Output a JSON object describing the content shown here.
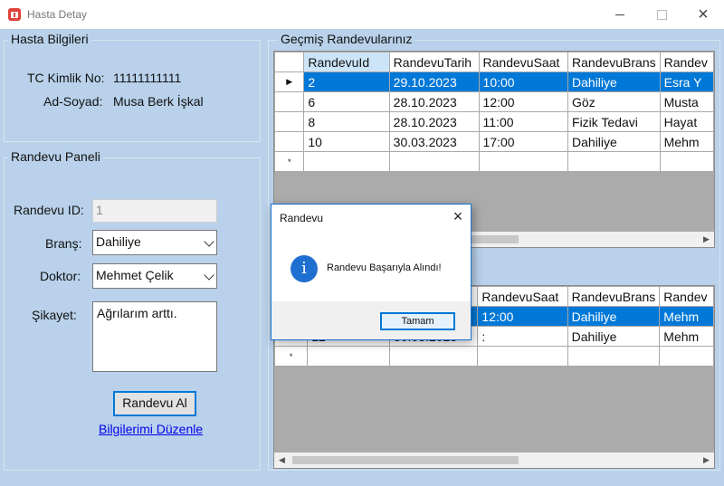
{
  "window": {
    "title": "Hasta Detay"
  },
  "patient_info": {
    "group_title": "Hasta Bilgileri",
    "tc_label": "TC Kimlik No:",
    "tc_value": "11111111111",
    "name_label": "Ad-Soyad:",
    "name_value": "Musa Berk İşkal"
  },
  "appointment_panel": {
    "group_title": "Randevu Paneli",
    "id_label": "Randevu ID:",
    "id_value": "1",
    "branch_label": "Branş:",
    "branch_value": "Dahiliye",
    "doctor_label": "Doktor:",
    "doctor_value": "Mehmet Çelik",
    "complaint_label": "Şikayet:",
    "complaint_value": "Ağrılarım arttı.",
    "submit_label": "Randevu Al",
    "edit_link": "Bilgilerimi Düzenle"
  },
  "history": {
    "group_title": "Geçmiş Randevularınız",
    "columns": [
      "RandevuId",
      "RandevuTarih",
      "RandevuSaat",
      "RandevuBrans",
      "Randev"
    ],
    "rows": [
      [
        "2",
        "29.10.2023",
        "10:00",
        "Dahiliye",
        "Esra Y"
      ],
      [
        "6",
        "28.10.2023",
        "12:00",
        "Göz",
        "Musta"
      ],
      [
        "8",
        "28.10.2023",
        "11:00",
        "Fizik Tedavi",
        "Hayat"
      ],
      [
        "10",
        "30.03.2023",
        "17:00",
        "Dahiliye",
        "Mehm"
      ]
    ],
    "selected_row_marker": "▶",
    "new_row_marker": "*"
  },
  "active": {
    "columns": [
      "",
      "",
      "RandevuSaat",
      "RandevuBrans",
      "Randev"
    ],
    "rows": [
      [
        "",
        "",
        "12:00",
        "Dahiliye",
        "Mehm"
      ],
      [
        "12",
        "30.03.2023",
        ":",
        "Dahiliye",
        "Mehm"
      ]
    ],
    "new_row_marker": "*"
  },
  "dialog": {
    "title": "Randevu",
    "message": "Randevu Başarıyla Alındı!",
    "ok_label": "Tamam",
    "icon_glyph": "i"
  },
  "colors": {
    "form_bg": "#b9d1ea",
    "selection": "#0078d7",
    "grid_bg": "#ababab"
  }
}
